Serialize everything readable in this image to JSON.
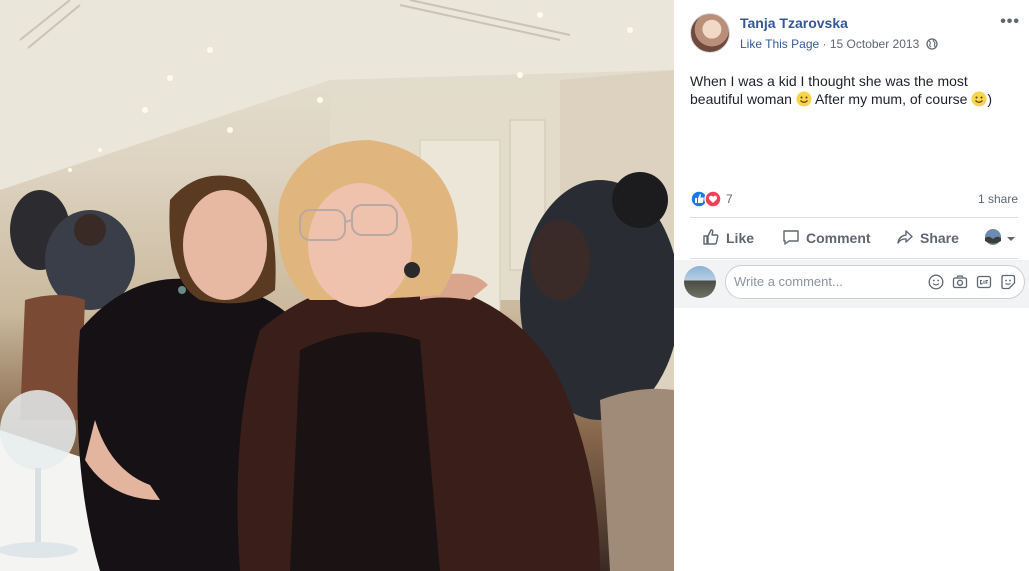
{
  "post": {
    "page_name": "Tanja Tzarovska",
    "like_page": "Like This Page",
    "separator": "·",
    "date": "15 October 2013",
    "text_line1": "When I was a kid I thought she was the most",
    "text_line2_a": "beautiful woman",
    "text_line2_b": "After my mum, of course",
    "text_line2_c": ")",
    "more_glyph": "•••"
  },
  "stats": {
    "reaction_count": "7",
    "shares": "1 share"
  },
  "actions": {
    "like": "Like",
    "comment": "Comment",
    "share": "Share"
  },
  "comment": {
    "placeholder": "Write a comment..."
  },
  "icons": [
    "globe-icon",
    "smiley-icon",
    "like-reaction-icon",
    "love-reaction-icon",
    "like-icon",
    "comment-icon",
    "share-icon",
    "audience-icon",
    "chevron-down-icon",
    "emoji-icon",
    "camera-icon",
    "gif-icon",
    "sticker-icon"
  ],
  "colors": {
    "link": "#365899",
    "muted": "#606770",
    "like_blue": "#1877f2",
    "love_red": "#f33e58"
  }
}
